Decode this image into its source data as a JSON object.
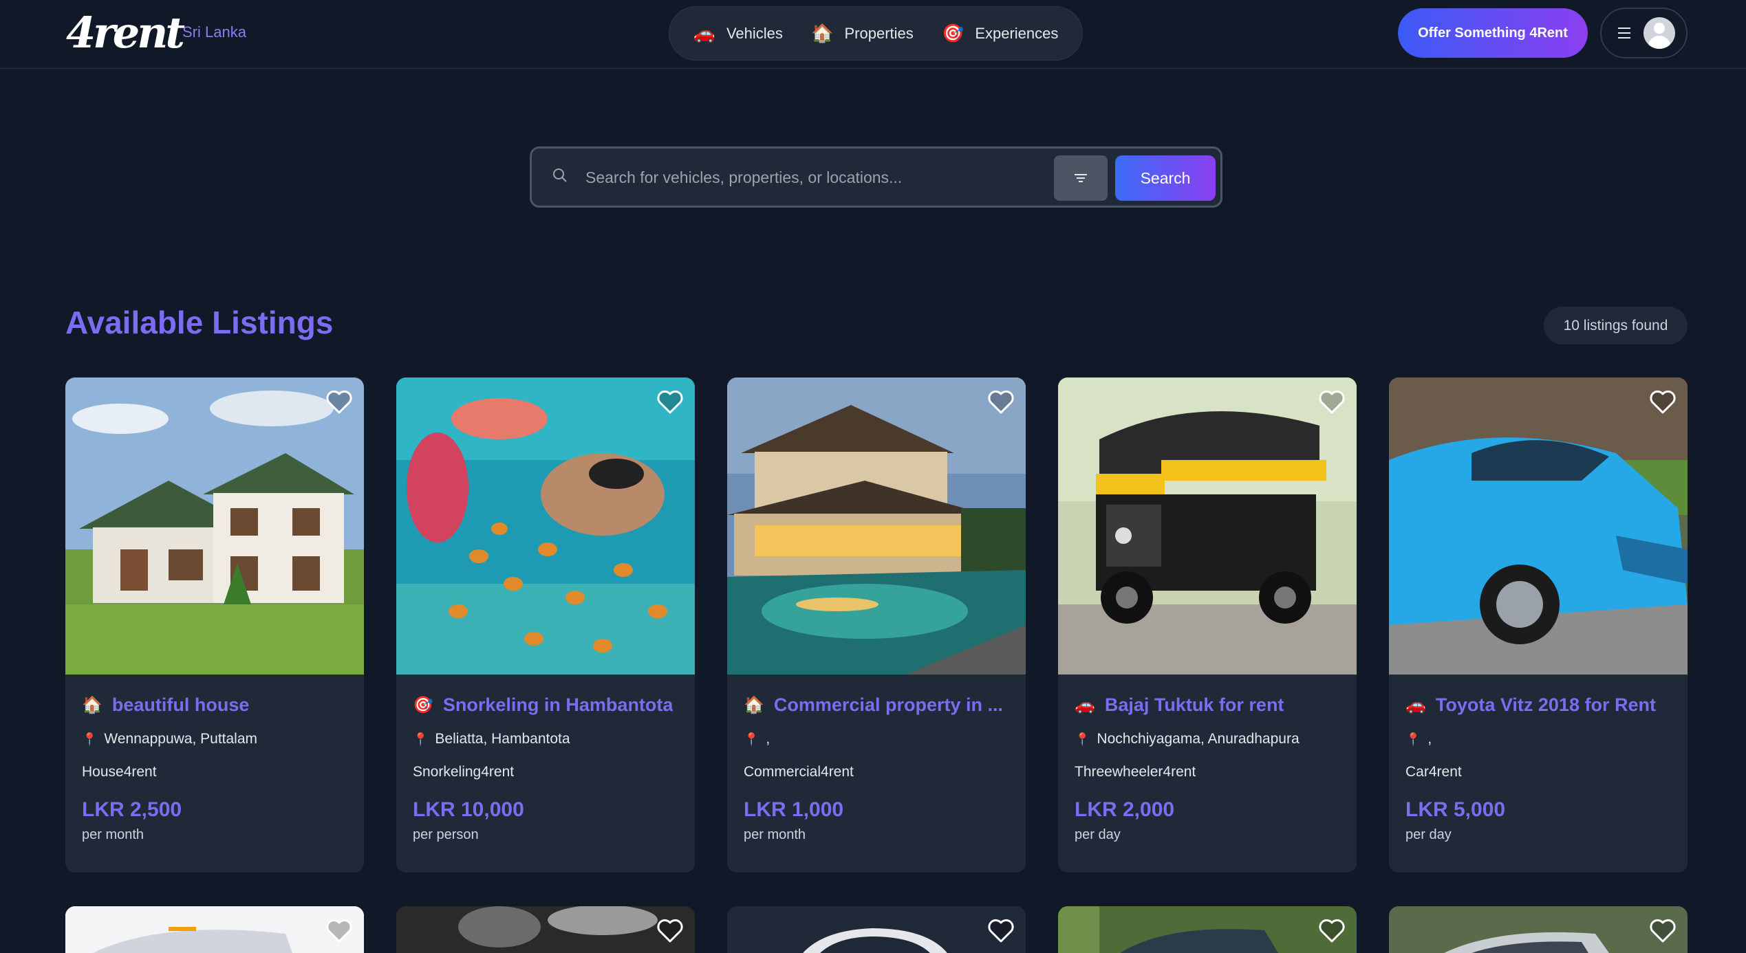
{
  "header": {
    "logo_text": "4rent",
    "region": "Sri Lanka",
    "nav": [
      {
        "label": "Vehicles",
        "icon": "🚗",
        "icon_name": "car-icon"
      },
      {
        "label": "Properties",
        "icon": "🏠",
        "icon_name": "house-icon"
      },
      {
        "label": "Experiences",
        "icon": "🎯",
        "icon_name": "target-icon"
      }
    ],
    "offer_button": "Offer Something 4Rent"
  },
  "search": {
    "placeholder": "Search for vehicles, properties, or locations...",
    "button": "Search"
  },
  "listings": {
    "title": "Available Listings",
    "count_text": "10 listings found",
    "items": [
      {
        "icon": "🏠",
        "title": "beautiful house",
        "location": "Wennappuwa, Puttalam",
        "type": "House4rent",
        "price": "LKR 2,500",
        "unit": "per month"
      },
      {
        "icon": "🎯",
        "title": "Snorkeling in Hambantota",
        "location": "Beliatta, Hambantota",
        "type": "Snorkeling4rent",
        "price": "LKR 10,000",
        "unit": "per person"
      },
      {
        "icon": "🏠",
        "title": "Commercial property in ...",
        "location": ",",
        "type": "Commercial4rent",
        "price": "LKR 1,000",
        "unit": "per month"
      },
      {
        "icon": "🚗",
        "title": "Bajaj Tuktuk for rent",
        "location": "Nochchiyagama, Anuradhapura",
        "type": "Threewheeler4rent",
        "price": "LKR 2,000",
        "unit": "per day"
      },
      {
        "icon": "🚗",
        "title": "Toyota Vitz 2018 for Rent",
        "location": ",",
        "type": "Car4rent",
        "price": "LKR 5,000",
        "unit": "per day"
      }
    ]
  },
  "colors": {
    "background": "#111827",
    "card": "#1f2937",
    "accent": "#7c6cf0",
    "gradient_start": "#3b5bf6",
    "gradient_end": "#8b3ff0"
  }
}
